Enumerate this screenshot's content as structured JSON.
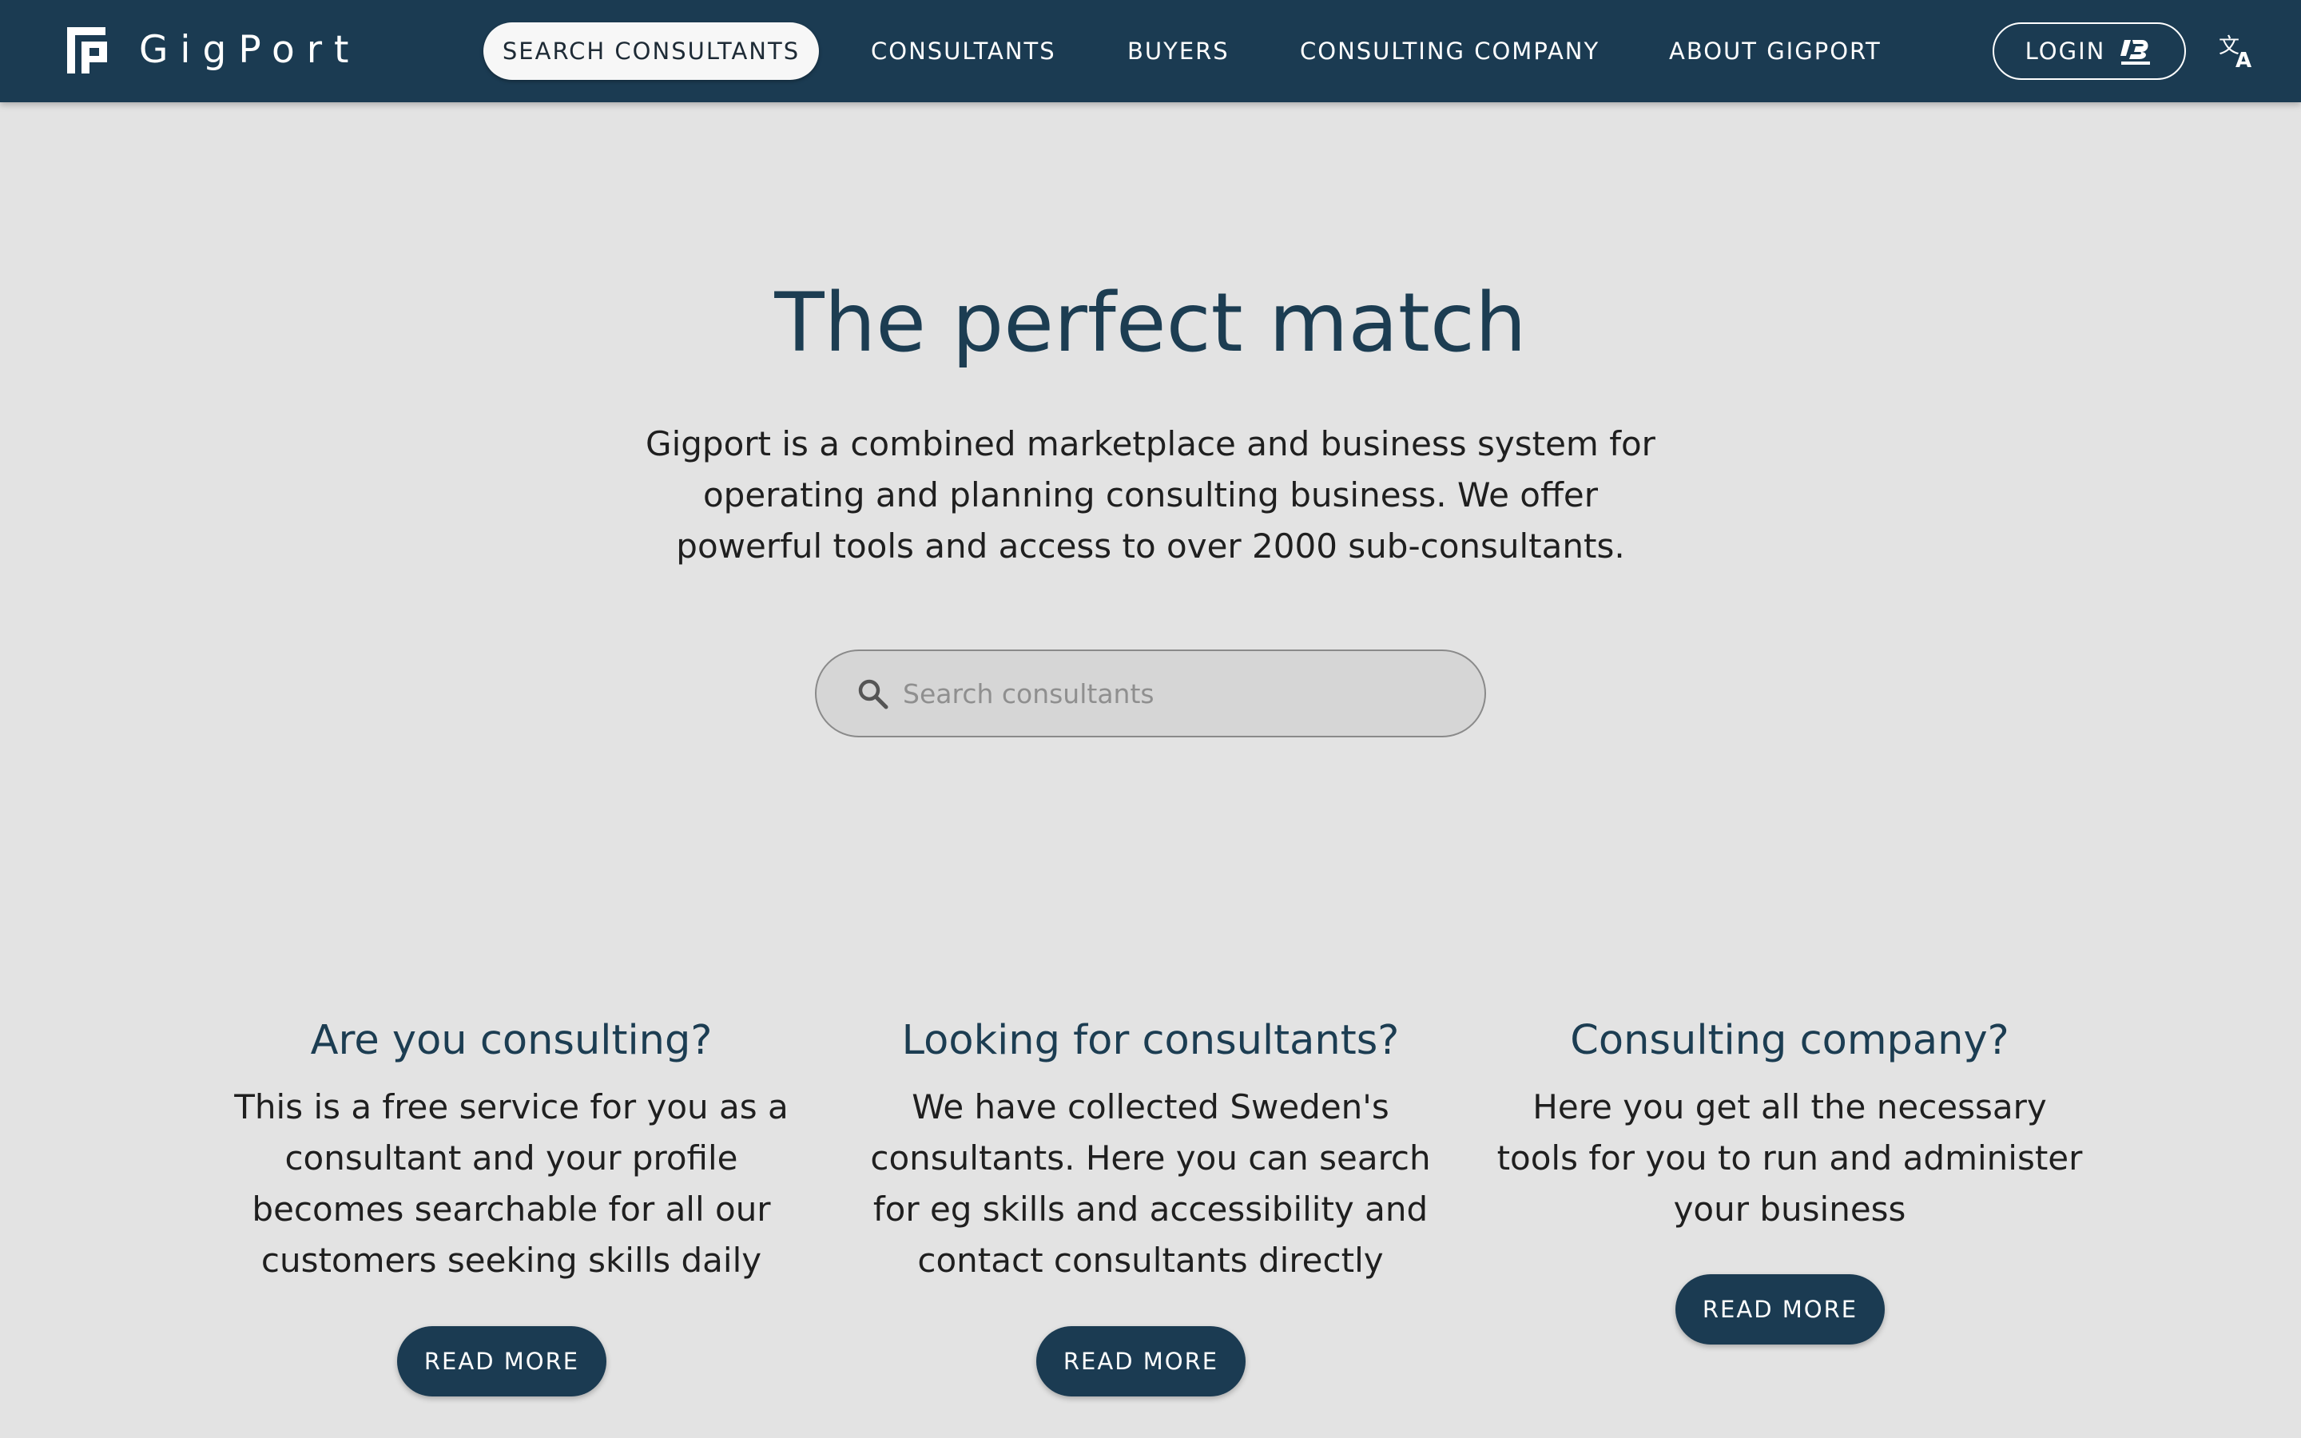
{
  "header": {
    "brand": "GigPort",
    "nav": {
      "search_consultants": "SEARCH CONSULTANTS",
      "consultants": "CONSULTANTS",
      "buyers": "BUYERS",
      "consulting_company": "CONSULTING COMPANY",
      "about": "ABOUT GIGPORT"
    },
    "login_label": "LOGIN",
    "bankid_label": "BankID",
    "icons": [
      "gigport-logo-icon",
      "bankid-icon",
      "translate-icon"
    ]
  },
  "hero": {
    "title": "The perfect match",
    "text": "Gigport is a combined marketplace and business system for operating and planning consulting business. We offer powerful tools and access to over 2000 sub-consultants.",
    "search_placeholder": "Search consultants",
    "search_value": ""
  },
  "cards": [
    {
      "title": "Are you consulting?",
      "text": "This is a free service for you as a consultant and your profile becomes searchable for all our customers seeking skills daily",
      "button": "READ MORE"
    },
    {
      "title": "Looking for consultants?",
      "text": "We have collected Sweden's consultants. Here you can search for eg skills and accessibility and contact consultants directly",
      "button": "READ MORE"
    },
    {
      "title": "Consulting company?",
      "text": "Here you get all the necessary tools for you to run and administer your business",
      "button": "READ MORE"
    }
  ],
  "colors": {
    "header_bg": "#1b3b52",
    "page_bg": "#e3e3e3",
    "heading": "#1c3d52",
    "button_bg": "#1b3b52"
  }
}
